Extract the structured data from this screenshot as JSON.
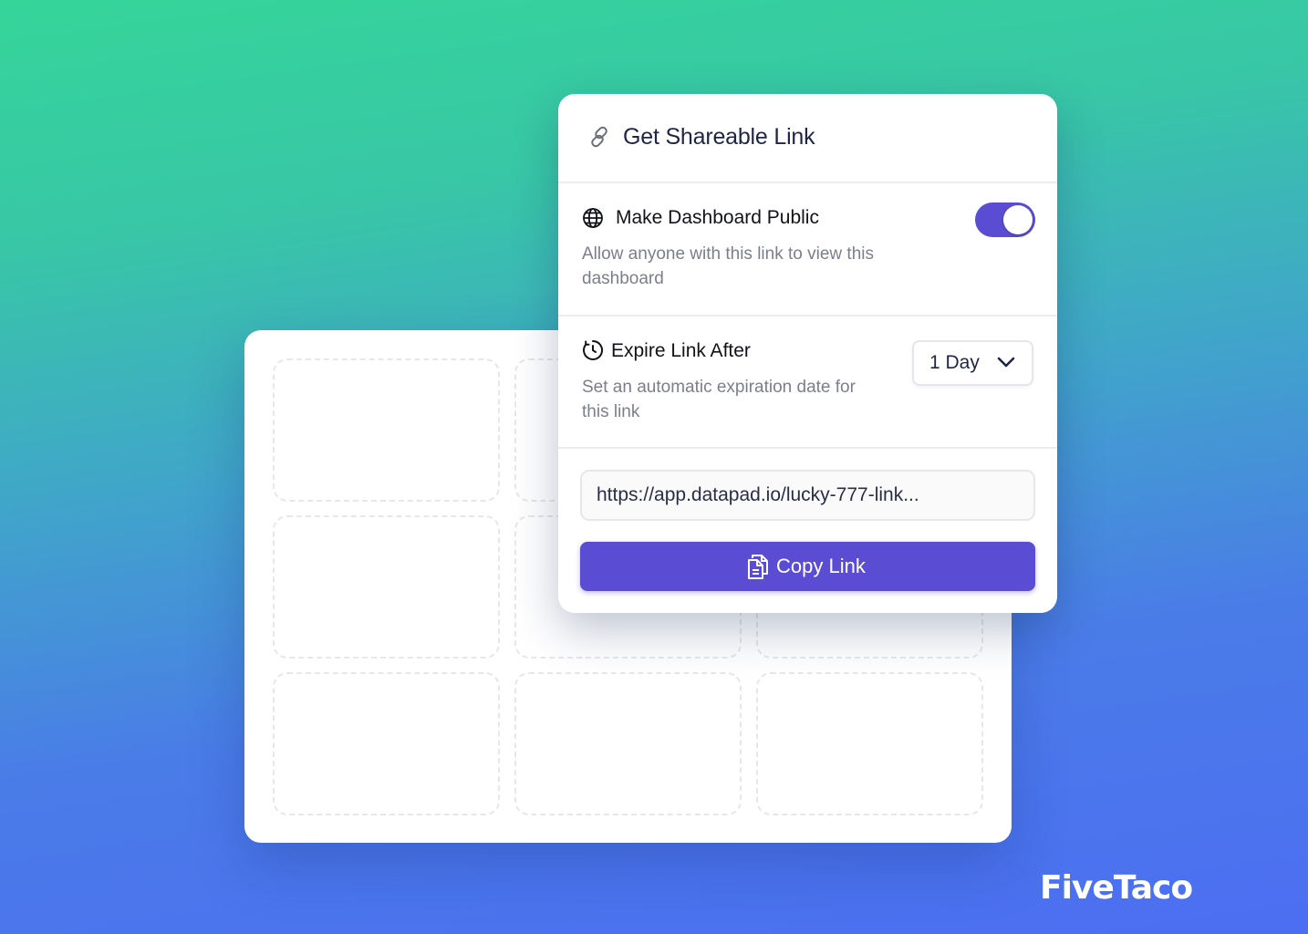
{
  "panel": {
    "title": "Get Shareable Link",
    "title_icon": "link-icon"
  },
  "public_section": {
    "icon": "globe-icon",
    "title": "Make Dashboard Public",
    "description": "Allow anyone with this link to view this dashboard",
    "toggle_on": true,
    "toggle_color": "#5b4dd3"
  },
  "expire_section": {
    "icon": "timer-icon",
    "title": "Expire Link After",
    "description": "Set an automatic expiration date for this link",
    "selected_option": "1 Day"
  },
  "link_field": {
    "value": "https://app.datapad.io/lucky-777-link..."
  },
  "copy_button": {
    "icon": "copy-icon",
    "label": "Copy Link",
    "color": "#5b4dd3"
  },
  "brand": {
    "logo_text": "FiveTaco"
  }
}
